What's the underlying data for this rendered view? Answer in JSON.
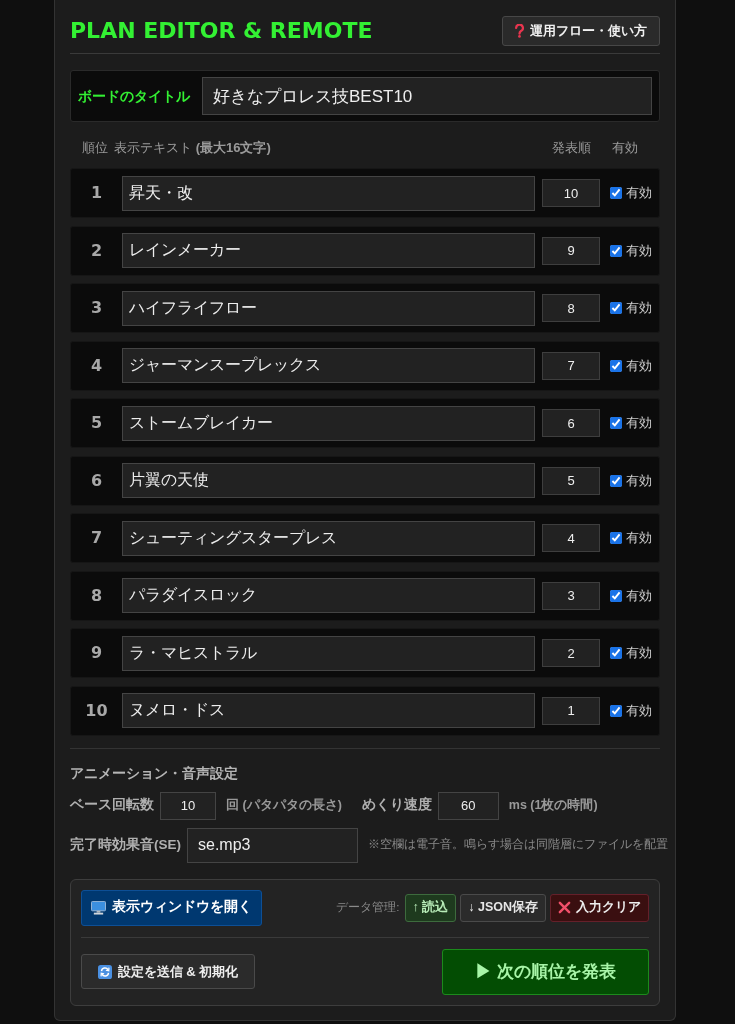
{
  "header": {
    "title": "PLAN EDITOR & REMOTE",
    "help_button": "運用フロー・使い方"
  },
  "board_title": {
    "label": "ボードのタイトル",
    "value": "好きなプロレス技BEST10"
  },
  "columns": [
    "順位",
    "表示テキスト **(最大16文字)**",
    "発表順",
    "有効"
  ],
  "rows": [
    {
      "rank": "1",
      "text": "昇天・改",
      "order": "10",
      "enabled": true,
      "enabled_label": "有効"
    },
    {
      "rank": "2",
      "text": "レインメーカー",
      "order": "9",
      "enabled": true,
      "enabled_label": "有効"
    },
    {
      "rank": "3",
      "text": "ハイフライフロー",
      "order": "8",
      "enabled": true,
      "enabled_label": "有効"
    },
    {
      "rank": "4",
      "text": "ジャーマンスープレックス",
      "order": "7",
      "enabled": true,
      "enabled_label": "有効"
    },
    {
      "rank": "5",
      "text": "ストームブレイカー",
      "order": "6",
      "enabled": true,
      "enabled_label": "有効"
    },
    {
      "rank": "6",
      "text": "片翼の天使",
      "order": "5",
      "enabled": true,
      "enabled_label": "有効"
    },
    {
      "rank": "7",
      "text": "シューティングスタープレス",
      "order": "4",
      "enabled": true,
      "enabled_label": "有効"
    },
    {
      "rank": "8",
      "text": "パラダイスロック",
      "order": "3",
      "enabled": true,
      "enabled_label": "有効"
    },
    {
      "rank": "9",
      "text": "ラ・マヒストラル",
      "order": "2",
      "enabled": true,
      "enabled_label": "有効"
    },
    {
      "rank": "10",
      "text": "ヌメロ・ドス",
      "order": "1",
      "enabled": true,
      "enabled_label": "有効"
    }
  ],
  "animation_settings": {
    "title": "アニメーション・音声設定",
    "fields": [
      {
        "label": "ベース回転数",
        "value": "10",
        "unit": "回 (パタパタの長さ)"
      },
      {
        "label": "めくり速度",
        "value": "60",
        "unit": "ms (1枚の時間)"
      }
    ],
    "sound": {
      "label": "完了時効果音(SE)",
      "value": "se.mp3",
      "note": "※空欄は電子音。鳴らす場合は同階層にファイルを配置"
    }
  },
  "controls": {
    "open_window_button": "表示ウィンドウを開く",
    "data_label": "データ管理:",
    "data_buttons": [
      {
        "kind": "load",
        "label": "↑ 読込"
      },
      {
        "kind": "save",
        "label": "↓ JSON保存"
      },
      {
        "kind": "clear",
        "label": "入力クリア"
      }
    ],
    "send_button": "設定を送信 & 初期化",
    "next_button": "▶ 次の順位を発表"
  }
}
